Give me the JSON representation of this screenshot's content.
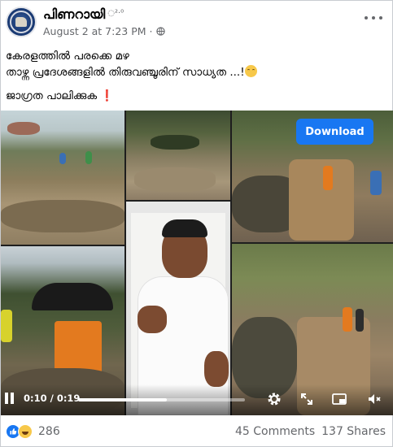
{
  "post": {
    "author": "പിണറായി",
    "author_badge": "◌²·⁰",
    "date": "August 2 at 7:23 PM",
    "separator": "·",
    "lines": [
      "കേരളത്തിൽ പരക്കെ മഴ",
      "താഴ്ന്ന പ്രദേശങ്ങളിൽ തിരുവഞ്ചൂരിന് സാധ്യത ...!"
    ],
    "line3": "ജാഗ്രത പാലിക്കുക ",
    "line3_mark": "❗"
  },
  "video": {
    "download_label": "Download",
    "current_time": "0:10",
    "time_separator": " / ",
    "duration": "0:19",
    "progress_fraction": 0.53
  },
  "footer": {
    "reaction_count": "286",
    "comments": "45 Comments",
    "shares": "137 Shares"
  },
  "icons": {
    "globe": "globe-icon",
    "more": "more-options-icon",
    "settings": "gear-icon",
    "fullscreen": "expand-icon",
    "pip": "picture-in-picture-icon",
    "mute": "muted-speaker-icon"
  },
  "colors": {
    "accent": "#1877f2",
    "secondary_text": "#65676b"
  }
}
